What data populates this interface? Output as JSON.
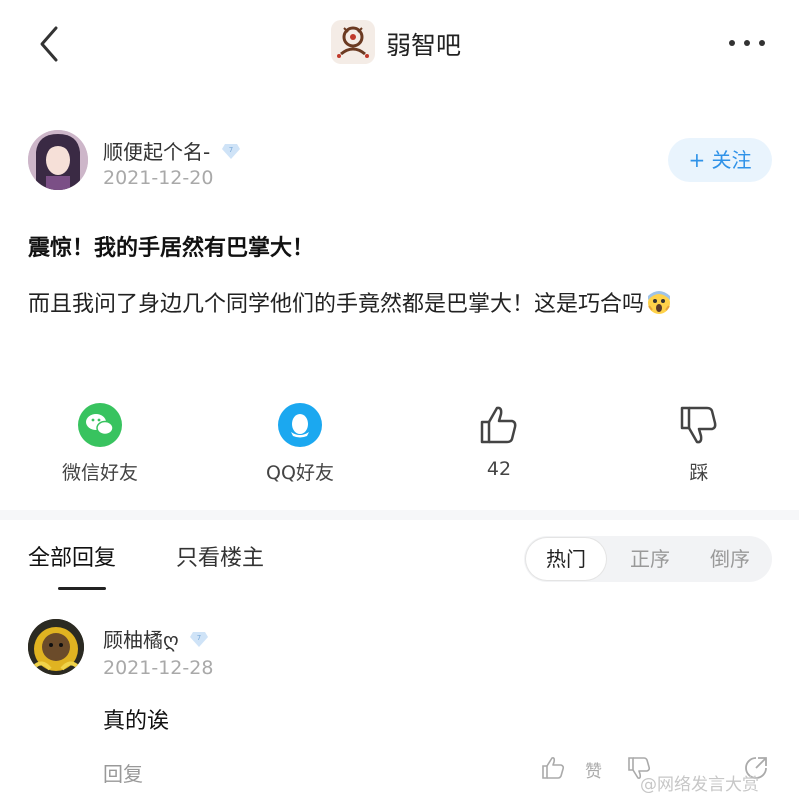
{
  "header": {
    "back_icon": "chevron-left-icon",
    "forum_name": "弱智吧",
    "more_icon": "more-dots-icon"
  },
  "post": {
    "author": "顺便起个名-",
    "badge_icon": "diamond-level-badge-icon",
    "date": "2021-12-20",
    "follow_label": "+ 关注",
    "title": "震惊！我的手居然有巴掌大！",
    "body": "而且我问了身边几个同学他们的手竟然都是巴掌大！这是巧合吗",
    "emoji_icon": "scared-face-emoji-icon"
  },
  "actions": {
    "wechat_label": "微信好友",
    "qq_label": "QQ好友",
    "like_count": "42",
    "dislike_label": "踩"
  },
  "tabs": {
    "all_replies": "全部回复",
    "owner_only": "只看楼主",
    "sort": [
      "热门",
      "正序",
      "倒序"
    ],
    "sort_selected": "热门"
  },
  "comment": {
    "author": "顾柚橘ღ",
    "date": "2021-12-28",
    "text": "真的诶",
    "reply_label": "回复",
    "like_label": "赞"
  },
  "watermark": "@网络发言大赏",
  "colors": {
    "accent": "#2f92e8",
    "wechat_green": "#38c35f",
    "qq_blue": "#1ba8f0",
    "meta_gray": "#a9a9a9"
  }
}
